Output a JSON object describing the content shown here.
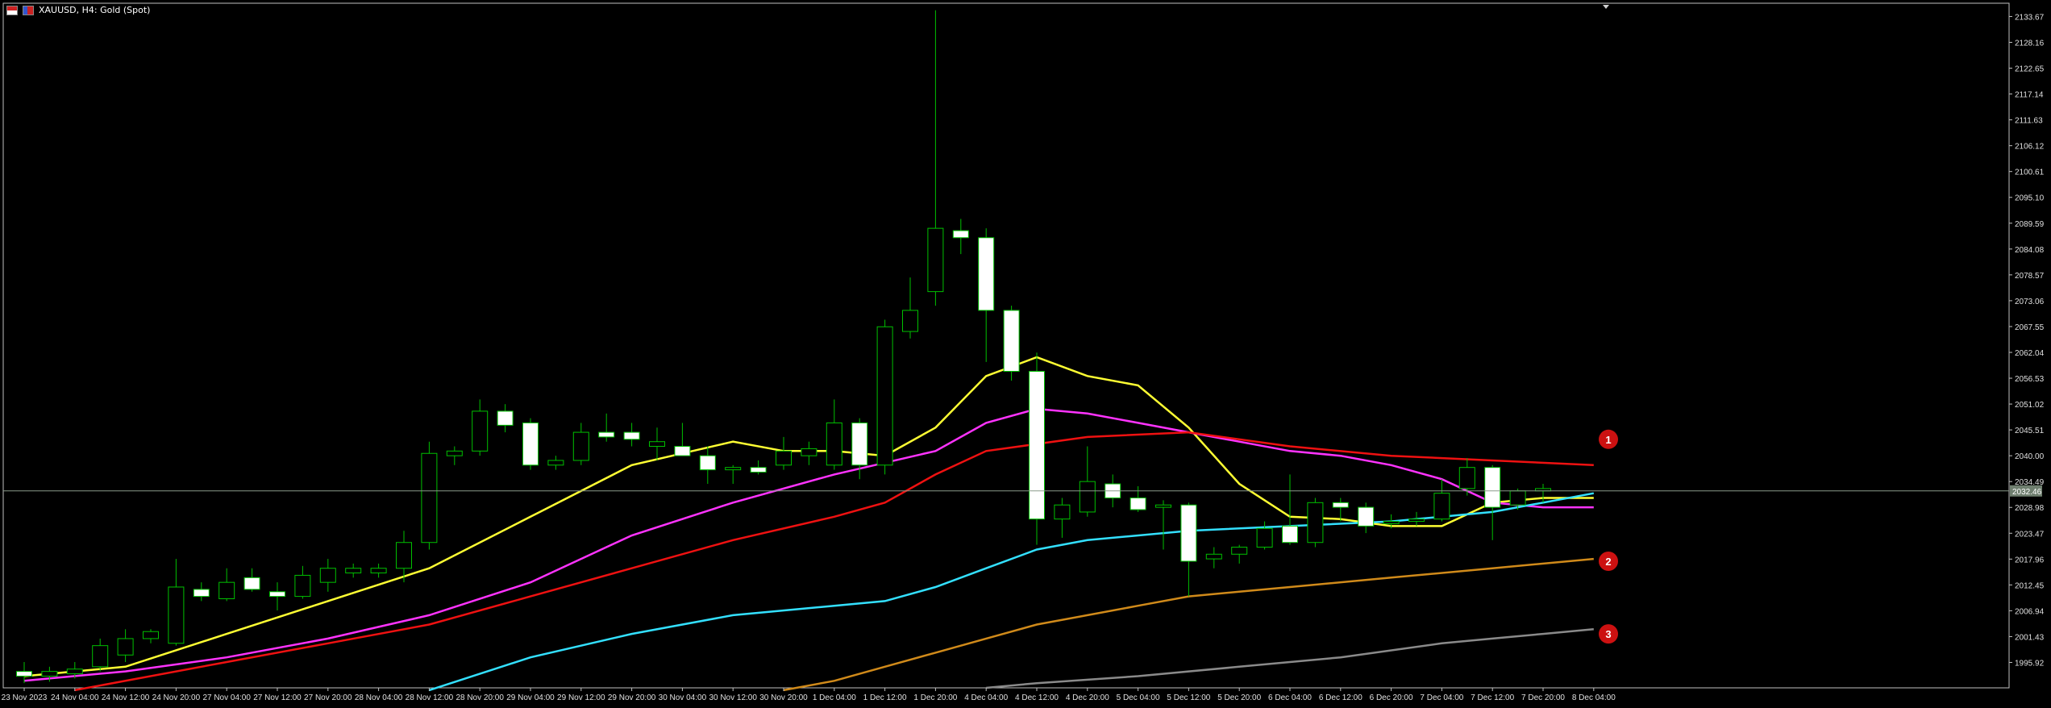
{
  "window": {
    "title": "XAUUSD, H4:  Gold (Spot)"
  },
  "colors": {
    "background": "#000000",
    "axis": "#bfbfbf",
    "bull_candle": "#00c000",
    "bear_candle": "#ffffff",
    "ma_fast": "#ffff33",
    "ma_2": "#ff33ff",
    "ma_3": "#ee1111",
    "ma_4": "#33e0ff",
    "ma_5": "#d08a1a",
    "ma_6": "#8a8a8a",
    "marker": "#cc1111",
    "price_line": "#8a9a8a"
  },
  "markers": [
    "1",
    "2",
    "3"
  ],
  "chart_data": {
    "type": "candlestick",
    "symbol": "XAUUSD",
    "timeframe": "H4",
    "ylim": [
      1990.5,
      2136.5
    ],
    "current_price": 2032.5,
    "current_price_label": "2032.46",
    "y_ticks": [
      "2133.67",
      "2128.16",
      "2122.65",
      "2117.14",
      "2111.63",
      "2106.12",
      "2100.61",
      "2095.10",
      "2089.59",
      "2084.08",
      "2078.57",
      "2073.06",
      "2067.55",
      "2062.04",
      "2056.53",
      "2051.02",
      "2045.51",
      "2040.00",
      "2034.49",
      "2028.98",
      "2023.47",
      "2017.96",
      "2012.45",
      "2006.94",
      "2001.43",
      "1995.92"
    ],
    "x_ticks": [
      {
        "i": 0,
        "label": "23 Nov 2023"
      },
      {
        "i": 2,
        "label": "24 Nov 04:00"
      },
      {
        "i": 4,
        "label": "24 Nov 12:00"
      },
      {
        "i": 6,
        "label": "24 Nov 20:00"
      },
      {
        "i": 8,
        "label": "27 Nov 04:00"
      },
      {
        "i": 10,
        "label": "27 Nov 12:00"
      },
      {
        "i": 12,
        "label": "27 Nov 20:00"
      },
      {
        "i": 14,
        "label": "28 Nov 04:00"
      },
      {
        "i": 16,
        "label": "28 Nov 12:00"
      },
      {
        "i": 18,
        "label": "28 Nov 20:00"
      },
      {
        "i": 20,
        "label": "29 Nov 04:00"
      },
      {
        "i": 22,
        "label": "29 Nov 12:00"
      },
      {
        "i": 24,
        "label": "29 Nov 20:00"
      },
      {
        "i": 26,
        "label": "30 Nov 04:00"
      },
      {
        "i": 28,
        "label": "30 Nov 12:00"
      },
      {
        "i": 30,
        "label": "30 Nov 20:00"
      },
      {
        "i": 32,
        "label": "1 Dec 04:00"
      },
      {
        "i": 34,
        "label": "1 Dec 12:00"
      },
      {
        "i": 36,
        "label": "1 Dec 20:00"
      },
      {
        "i": 38,
        "label": "4 Dec 04:00"
      },
      {
        "i": 40,
        "label": "4 Dec 12:00"
      },
      {
        "i": 42,
        "label": "4 Dec 20:00"
      },
      {
        "i": 44,
        "label": "5 Dec 04:00"
      },
      {
        "i": 46,
        "label": "5 Dec 12:00"
      },
      {
        "i": 48,
        "label": "5 Dec 20:00"
      },
      {
        "i": 50,
        "label": "6 Dec 04:00"
      },
      {
        "i": 52,
        "label": "6 Dec 12:00"
      },
      {
        "i": 54,
        "label": "6 Dec 20:00"
      },
      {
        "i": 56,
        "label": "7 Dec 04:00"
      },
      {
        "i": 58,
        "label": "7 Dec 12:00"
      },
      {
        "i": 60,
        "label": "7 Dec 20:00"
      },
      {
        "i": 62,
        "label": "8 Dec 04:00"
      }
    ],
    "candles": [
      {
        "o": 1994,
        "h": 1996,
        "l": 1991.5,
        "c": 1993
      },
      {
        "o": 1993,
        "h": 1995,
        "l": 1991.8,
        "c": 1994
      },
      {
        "o": 1993.5,
        "h": 1996,
        "l": 1992.5,
        "c": 1994.5
      },
      {
        "o": 1995,
        "h": 2001,
        "l": 1994,
        "c": 1999.5
      },
      {
        "o": 1997.5,
        "h": 2003,
        "l": 1996,
        "c": 2001
      },
      {
        "o": 2001,
        "h": 2003,
        "l": 2000,
        "c": 2002.5
      },
      {
        "o": 2000,
        "h": 2018,
        "l": 1999.5,
        "c": 2012
      },
      {
        "o": 2011.5,
        "h": 2013,
        "l": 2009,
        "c": 2010
      },
      {
        "o": 2009.5,
        "h": 2016,
        "l": 2009,
        "c": 2013
      },
      {
        "o": 2014,
        "h": 2016,
        "l": 2011,
        "c": 2011.5
      },
      {
        "o": 2011,
        "h": 2013,
        "l": 2007,
        "c": 2010
      },
      {
        "o": 2010,
        "h": 2016.5,
        "l": 2009.5,
        "c": 2014.5
      },
      {
        "o": 2013,
        "h": 2018,
        "l": 2011,
        "c": 2016
      },
      {
        "o": 2015,
        "h": 2017,
        "l": 2014,
        "c": 2016
      },
      {
        "o": 2015,
        "h": 2017,
        "l": 2014,
        "c": 2016
      },
      {
        "o": 2016,
        "h": 2024,
        "l": 2013,
        "c": 2021.5
      },
      {
        "o": 2021.5,
        "h": 2043,
        "l": 2020,
        "c": 2040.5
      },
      {
        "o": 2040,
        "h": 2042,
        "l": 2038,
        "c": 2041
      },
      {
        "o": 2041,
        "h": 2052,
        "l": 2040,
        "c": 2049.5
      },
      {
        "o": 2049.5,
        "h": 2051,
        "l": 2045,
        "c": 2046.5
      },
      {
        "o": 2047,
        "h": 2048,
        "l": 2037,
        "c": 2038
      },
      {
        "o": 2038,
        "h": 2040,
        "l": 2037,
        "c": 2039
      },
      {
        "o": 2039,
        "h": 2047,
        "l": 2038,
        "c": 2045
      },
      {
        "o": 2045,
        "h": 2049,
        "l": 2043,
        "c": 2044
      },
      {
        "o": 2045,
        "h": 2047,
        "l": 2042,
        "c": 2043.5
      },
      {
        "o": 2042,
        "h": 2046,
        "l": 2039,
        "c": 2043
      },
      {
        "o": 2042,
        "h": 2047,
        "l": 2040,
        "c": 2040
      },
      {
        "o": 2040,
        "h": 2042,
        "l": 2034,
        "c": 2037
      },
      {
        "o": 2037,
        "h": 2038,
        "l": 2034,
        "c": 2037.5
      },
      {
        "o": 2037.5,
        "h": 2039,
        "l": 2036,
        "c": 2036.5
      },
      {
        "o": 2038,
        "h": 2044,
        "l": 2037,
        "c": 2041
      },
      {
        "o": 2040,
        "h": 2043,
        "l": 2038,
        "c": 2041.5
      },
      {
        "o": 2038,
        "h": 2052,
        "l": 2037,
        "c": 2047
      },
      {
        "o": 2047,
        "h": 2048,
        "l": 2035,
        "c": 2038
      },
      {
        "o": 2038,
        "h": 2069,
        "l": 2036,
        "c": 2067.5
      },
      {
        "o": 2066.5,
        "h": 2078,
        "l": 2065,
        "c": 2071
      },
      {
        "o": 2075,
        "h": 2135,
        "l": 2072,
        "c": 2088.5
      },
      {
        "o": 2088,
        "h": 2090.5,
        "l": 2083,
        "c": 2086.5
      },
      {
        "o": 2086.5,
        "h": 2088.5,
        "l": 2060,
        "c": 2071
      },
      {
        "o": 2071,
        "h": 2072,
        "l": 2056,
        "c": 2058
      },
      {
        "o": 2058,
        "h": 2062,
        "l": 2021,
        "c": 2026.5
      },
      {
        "o": 2026.5,
        "h": 2031,
        "l": 2022.5,
        "c": 2029.5
      },
      {
        "o": 2028,
        "h": 2042,
        "l": 2027,
        "c": 2034.5
      },
      {
        "o": 2034,
        "h": 2036,
        "l": 2029,
        "c": 2031
      },
      {
        "o": 2031,
        "h": 2033.5,
        "l": 2028,
        "c": 2028.5
      },
      {
        "o": 2029,
        "h": 2030.5,
        "l": 2020,
        "c": 2029.5
      },
      {
        "o": 2029.5,
        "h": 2030,
        "l": 2010,
        "c": 2017.5
      },
      {
        "o": 2018,
        "h": 2020.5,
        "l": 2016,
        "c": 2019
      },
      {
        "o": 2019,
        "h": 2021,
        "l": 2017,
        "c": 2020.5
      },
      {
        "o": 2020.5,
        "h": 2026,
        "l": 2020,
        "c": 2024.5
      },
      {
        "o": 2025,
        "h": 2036,
        "l": 2021,
        "c": 2021.5
      },
      {
        "o": 2021.5,
        "h": 2031,
        "l": 2020.5,
        "c": 2030
      },
      {
        "o": 2030,
        "h": 2031,
        "l": 2026,
        "c": 2029
      },
      {
        "o": 2029,
        "h": 2030,
        "l": 2023.5,
        "c": 2025
      },
      {
        "o": 2025.5,
        "h": 2027.5,
        "l": 2024.5,
        "c": 2026
      },
      {
        "o": 2026,
        "h": 2028,
        "l": 2025,
        "c": 2026.5
      },
      {
        "o": 2026.5,
        "h": 2035,
        "l": 2026,
        "c": 2032
      },
      {
        "o": 2033,
        "h": 2039.5,
        "l": 2031.5,
        "c": 2037.5
      },
      {
        "o": 2037.5,
        "h": 2038,
        "l": 2022,
        "c": 2029
      },
      {
        "o": 2029.5,
        "h": 2033,
        "l": 2028.5,
        "c": 2032.5
      },
      {
        "o": 2032.5,
        "h": 2034,
        "l": 2030,
        "c": 2033
      }
    ],
    "series": [
      {
        "color": "#ffff33",
        "values": [
          [
            0,
            1993
          ],
          [
            4,
            1995
          ],
          [
            8,
            2002
          ],
          [
            12,
            2009
          ],
          [
            16,
            2016
          ],
          [
            20,
            2027
          ],
          [
            24,
            2038
          ],
          [
            28,
            2043
          ],
          [
            30,
            2041
          ],
          [
            32,
            2041
          ],
          [
            34,
            2040
          ],
          [
            36,
            2046
          ],
          [
            38,
            2057
          ],
          [
            40,
            2061
          ],
          [
            42,
            2057
          ],
          [
            44,
            2055
          ],
          [
            46,
            2046
          ],
          [
            48,
            2034
          ],
          [
            50,
            2027
          ],
          [
            52,
            2026.5
          ],
          [
            54,
            2025
          ],
          [
            56,
            2025
          ],
          [
            58,
            2030
          ],
          [
            60,
            2031
          ],
          [
            62,
            2031
          ]
        ]
      },
      {
        "color": "#ff33ff",
        "values": [
          [
            0,
            1992
          ],
          [
            4,
            1994
          ],
          [
            8,
            1997
          ],
          [
            12,
            2001
          ],
          [
            16,
            2006
          ],
          [
            20,
            2013
          ],
          [
            24,
            2023
          ],
          [
            28,
            2030
          ],
          [
            32,
            2036
          ],
          [
            36,
            2041
          ],
          [
            38,
            2047
          ],
          [
            40,
            2050
          ],
          [
            42,
            2049
          ],
          [
            44,
            2047
          ],
          [
            46,
            2045
          ],
          [
            48,
            2043
          ],
          [
            50,
            2041
          ],
          [
            52,
            2040
          ],
          [
            54,
            2038
          ],
          [
            56,
            2035
          ],
          [
            58,
            2030
          ],
          [
            60,
            2029
          ],
          [
            62,
            2029
          ]
        ]
      },
      {
        "color": "#ee1111",
        "values": [
          [
            2,
            1990
          ],
          [
            8,
            1996
          ],
          [
            12,
            2000
          ],
          [
            16,
            2004
          ],
          [
            20,
            2010
          ],
          [
            24,
            2016
          ],
          [
            28,
            2022
          ],
          [
            32,
            2027
          ],
          [
            34,
            2030
          ],
          [
            36,
            2036
          ],
          [
            38,
            2041
          ],
          [
            42,
            2044
          ],
          [
            46,
            2045
          ],
          [
            50,
            2042
          ],
          [
            54,
            2040
          ],
          [
            58,
            2039
          ],
          [
            62,
            2038
          ]
        ]
      },
      {
        "color": "#33e0ff",
        "values": [
          [
            16,
            1990
          ],
          [
            20,
            1997
          ],
          [
            24,
            2002
          ],
          [
            28,
            2006
          ],
          [
            32,
            2008
          ],
          [
            34,
            2009
          ],
          [
            36,
            2012
          ],
          [
            38,
            2016
          ],
          [
            40,
            2020
          ],
          [
            42,
            2022
          ],
          [
            46,
            2024
          ],
          [
            50,
            2025
          ],
          [
            54,
            2026
          ],
          [
            58,
            2028
          ],
          [
            62,
            2032
          ]
        ]
      },
      {
        "color": "#d08a1a",
        "values": [
          [
            30,
            1990
          ],
          [
            32,
            1992
          ],
          [
            34,
            1995
          ],
          [
            36,
            1998
          ],
          [
            38,
            2001
          ],
          [
            40,
            2004
          ],
          [
            42,
            2006
          ],
          [
            44,
            2008
          ],
          [
            46,
            2010
          ],
          [
            48,
            2011
          ],
          [
            50,
            2012
          ],
          [
            54,
            2014
          ],
          [
            58,
            2016
          ],
          [
            62,
            2018
          ]
        ]
      },
      {
        "color": "#8a8a8a",
        "values": [
          [
            38,
            1990.5
          ],
          [
            40,
            1991.5
          ],
          [
            44,
            1993
          ],
          [
            48,
            1995
          ],
          [
            52,
            1997
          ],
          [
            56,
            2000
          ],
          [
            58,
            2001
          ],
          [
            60,
            2002
          ],
          [
            62,
            2003
          ]
        ]
      }
    ]
  }
}
